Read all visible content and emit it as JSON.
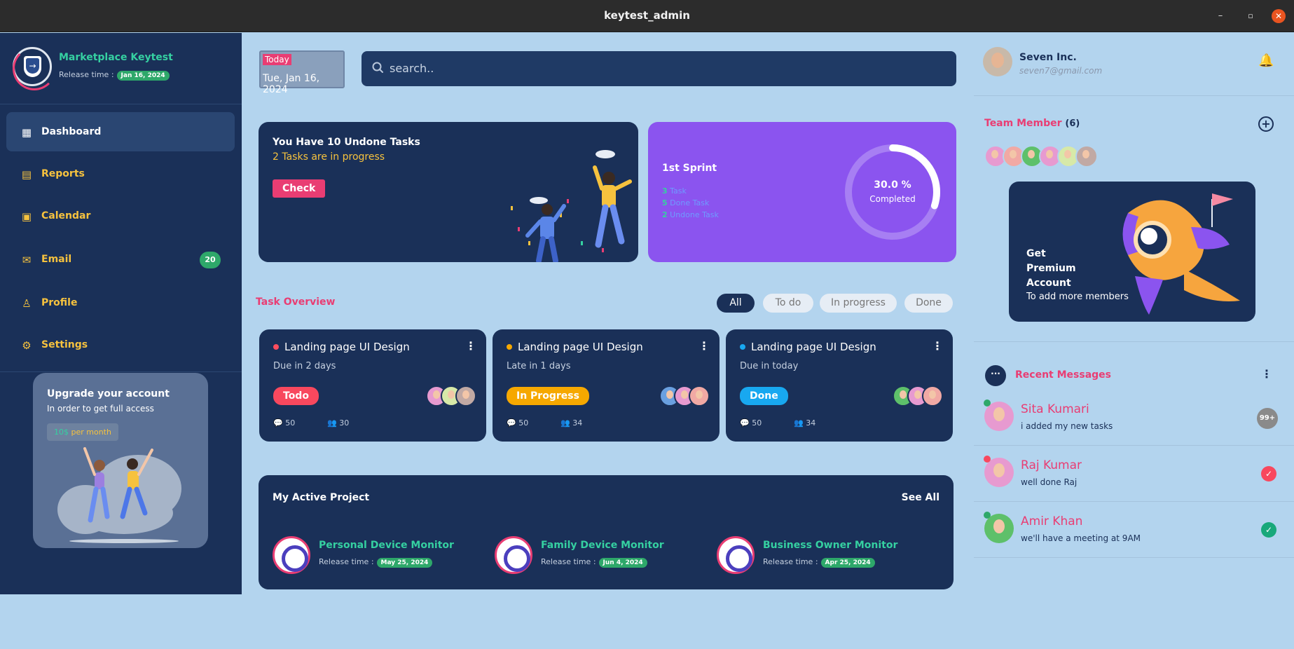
{
  "window": {
    "title": "keytest_admin",
    "min": "–",
    "max": "▫",
    "close": "✕"
  },
  "sidebar": {
    "brand_name": "Marketplace Keytest",
    "release_label": "Release time :",
    "release_date": "Jan 16, 2024",
    "items": [
      {
        "label": "Dashboard",
        "icon": "grid-icon",
        "glyph": "▦"
      },
      {
        "label": "Reports",
        "icon": "clipboard-icon",
        "glyph": "▤"
      },
      {
        "label": "Calendar",
        "icon": "calendar-icon",
        "glyph": "▣"
      },
      {
        "label": "Email",
        "icon": "mail-icon",
        "glyph": "✉",
        "badge": "20"
      },
      {
        "label": "Profile",
        "icon": "user-icon",
        "glyph": "♙"
      },
      {
        "label": "Settings",
        "icon": "gear-icon",
        "glyph": "⚙"
      }
    ],
    "upgrade": {
      "title": "Upgrade your account",
      "subtitle": "In order to get full access",
      "price_amount": "10$",
      "price_period": " per month"
    }
  },
  "header": {
    "today_label": "Today",
    "date": "Tue, Jan 16, 2024",
    "search_placeholder": "search.."
  },
  "tasks_banner": {
    "title": "You Have 10 Undone Tasks",
    "subtitle": "2 Tasks are in progress",
    "button": "Check"
  },
  "sprint": {
    "title": "1st Sprint",
    "task_count": "3",
    "task_label": "Task",
    "done_count": "5",
    "done_label": "Done Task",
    "undone_count": "2",
    "undone_label": "Undone Task",
    "progress_percent": 30,
    "percent_text": "30.0 %",
    "completed_label": "Completed"
  },
  "task_overview": {
    "title": "Task Overview",
    "filters": [
      "All",
      "To do",
      "In progress",
      "Done"
    ],
    "cards": [
      {
        "title": "Landing page UI Design",
        "due": "Due in 2 days",
        "status": "Todo",
        "comments": "50",
        "members": "30"
      },
      {
        "title": "Landing page UI Design",
        "due": "Late in 1 days",
        "status": "In Progress",
        "comments": "50",
        "members": "34"
      },
      {
        "title": "Landing page UI Design",
        "due": "Due in today",
        "status": "Done",
        "comments": "50",
        "members": "34"
      }
    ]
  },
  "projects": {
    "title": "My Active Project",
    "see_all": "See All",
    "release_label": "Release time :",
    "items": [
      {
        "name": "Personal Device Monitor",
        "date": "May 25, 2024"
      },
      {
        "name": "Family Device Monitor",
        "date": "Jun 4, 2024"
      },
      {
        "name": "Business Owner Monitor",
        "date": "Apr 25, 2024"
      }
    ]
  },
  "user": {
    "name": "Seven Inc.",
    "email": "seven7@gmail.com"
  },
  "team": {
    "title": "Team Member",
    "count": "(6)"
  },
  "premium": {
    "heading": "Get Premium Account",
    "subtitle": "To add more members"
  },
  "messages": {
    "title": "Recent Messages",
    "items": [
      {
        "name": "Sita Kumari",
        "text": "i added my new tasks",
        "badge": "99+"
      },
      {
        "name": "Raj Kumar",
        "text": "well done Raj",
        "status": "✓"
      },
      {
        "name": "Amir Khan",
        "text": "we'll have a meeting at 9AM",
        "status": "✓"
      }
    ]
  },
  "colors": {
    "navy": "#1a3058",
    "accent_pink": "#e93d73",
    "accent_green": "#35d0a1",
    "accent_yellow": "#f6c23e",
    "sprint_purple": "#8b54ef",
    "background": "#b3d4ee"
  }
}
